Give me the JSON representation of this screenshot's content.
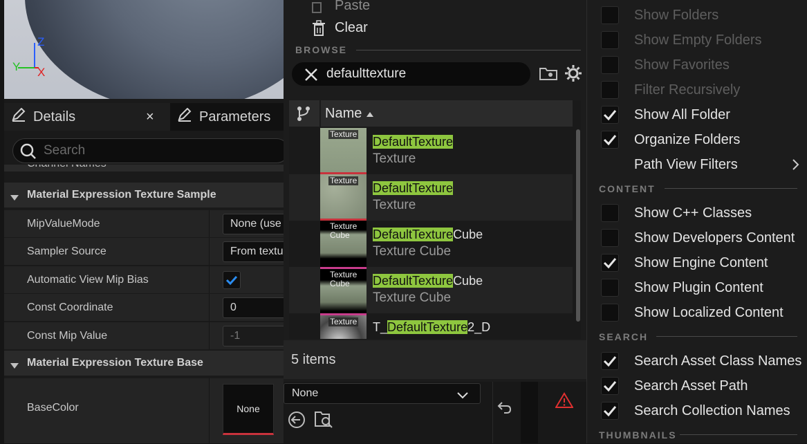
{
  "viewport": {
    "axis_z": "Z",
    "axis_y": "Y",
    "axis_x": "X"
  },
  "details": {
    "tab_details": "Details",
    "tab_parameters": "Parameters",
    "search_placeholder": "Search",
    "truncated_row": "Channel Names",
    "section_sample": "Material Expression Texture Sample",
    "rows": [
      {
        "label": "MipValueMode",
        "value": "None (use"
      },
      {
        "label": "Sampler Source",
        "value": "From textu"
      },
      {
        "label": "Automatic View Mip Bias",
        "value": ""
      },
      {
        "label": "Const Coordinate",
        "value": "0"
      },
      {
        "label": "Const Mip Value",
        "value": "-1"
      }
    ],
    "section_base": "Material Expression Texture Base",
    "basecolor_label": "BaseColor",
    "basecolor_value": "None"
  },
  "browser": {
    "menu_paste": "Paste",
    "menu_clear": "Clear",
    "browse_label": "BROWSE",
    "search_value": "defaulttexture",
    "column_name": "Name",
    "assets": [
      {
        "thumb_label": "Texture",
        "name_hl": "DefaultTexture",
        "name_rest": "",
        "type": "Texture"
      },
      {
        "thumb_label": "Texture",
        "name_hl": "DefaultTexture",
        "name_rest": "",
        "type": "Texture"
      },
      {
        "thumb_label": "Texture Cube",
        "name_hl": "DefaultTexture",
        "name_rest": "Cube",
        "type": "Texture Cube"
      },
      {
        "thumb_label": "Texture Cube",
        "name_hl": "DefaultTexture",
        "name_rest": "Cube",
        "type": "Texture Cube"
      },
      {
        "thumb_label": "Texture",
        "name_pre": "T_",
        "name_hl": "DefaultTexture",
        "name_rest": "2_D",
        "type": ""
      }
    ],
    "item_count": "5 items",
    "dropdown_value": "None"
  },
  "options": {
    "items_top": [
      {
        "label": "Show Folders",
        "checked": false,
        "enabled": false
      },
      {
        "label": "Show Empty Folders",
        "checked": false,
        "enabled": false
      },
      {
        "label": "Show Favorites",
        "checked": false,
        "enabled": false
      },
      {
        "label": "Filter Recursively",
        "checked": false,
        "enabled": false
      },
      {
        "label": "Show All Folder",
        "checked": true,
        "enabled": true
      },
      {
        "label": "Organize Folders",
        "checked": true,
        "enabled": true
      }
    ],
    "path_view_filters": "Path View Filters",
    "section_content": "CONTENT",
    "items_content": [
      {
        "label": "Show C++ Classes",
        "checked": false
      },
      {
        "label": "Show Developers Content",
        "checked": false
      },
      {
        "label": "Show Engine Content",
        "checked": true
      },
      {
        "label": "Show Plugin Content",
        "checked": false
      },
      {
        "label": "Show Localized Content",
        "checked": false
      }
    ],
    "section_search": "SEARCH",
    "items_search": [
      {
        "label": "Search Asset Class Names",
        "checked": true
      },
      {
        "label": "Search Asset Path",
        "checked": true
      },
      {
        "label": "Search Collection Names",
        "checked": true
      }
    ],
    "section_thumbnails": "THUMBNAILS"
  },
  "colors": {
    "highlight": "#8ec63f",
    "accent_blue": "#2a8cf0",
    "texture_red": "#c8323c",
    "cube_pink": "#c83c8c"
  }
}
